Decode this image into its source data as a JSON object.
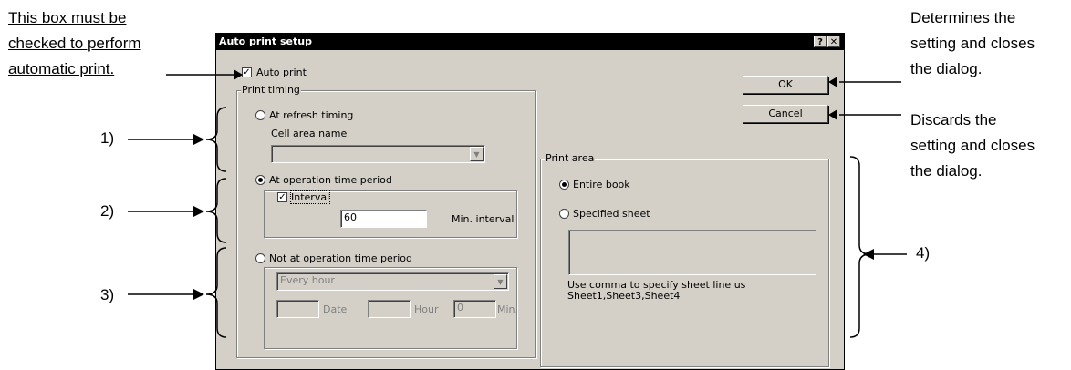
{
  "annotations": {
    "left_note": [
      "This box must be",
      "checked to perform",
      "automatic print."
    ],
    "ok_note": [
      "Determines the",
      "setting and closes",
      "the dialog."
    ],
    "cancel_note": [
      "Discards the",
      "setting and closes",
      "the dialog."
    ],
    "callouts": [
      "1)",
      "2)",
      "3)",
      "4)"
    ]
  },
  "dialog": {
    "title": "Auto print setup",
    "help_button": "?",
    "close_button": "✕",
    "auto_print_label": "Auto print",
    "auto_print_checked": true,
    "print_timing": {
      "group_label": "Print timing",
      "at_refresh_label": "At refresh timing",
      "cell_area_label": "Cell area name",
      "cell_area_value": "",
      "at_operation_label": "At operation time period",
      "interval_label": "Interval",
      "interval_checked": true,
      "interval_value": "60",
      "min_interval_label": "Min. interval",
      "not_at_operation_label": "Not at operation time period",
      "frequency_value": "Every hour",
      "date_value": "",
      "date_label": "Date",
      "hour_value": "",
      "hour_label": "Hour",
      "min_value": "0",
      "min_label": "Min."
    },
    "ok_label": "OK",
    "cancel_label": "Cancel",
    "print_area": {
      "group_label": "Print area",
      "entire_book_label": "Entire book",
      "specified_sheet_label": "Specified sheet",
      "sheet_value": "",
      "hint_line1": "Use comma to specify sheet line us",
      "hint_line2": "Sheet1,Sheet3,Sheet4"
    }
  }
}
